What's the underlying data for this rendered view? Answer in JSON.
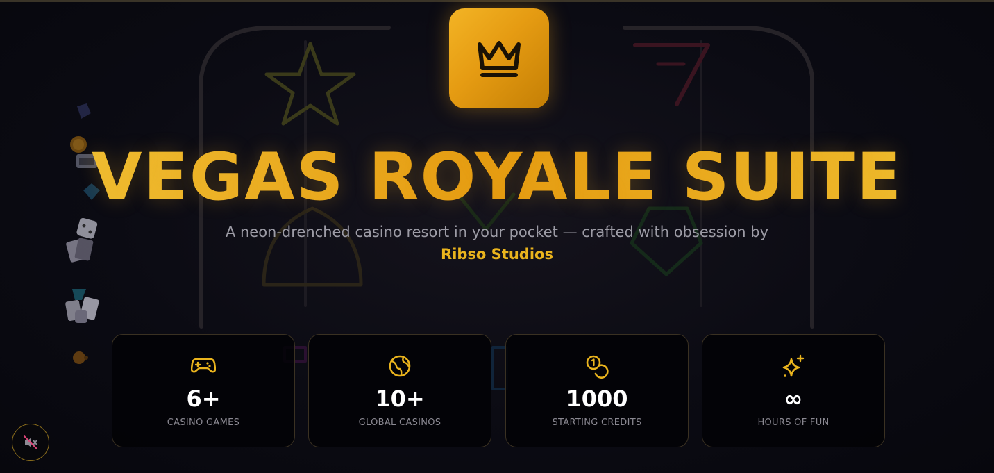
{
  "hero": {
    "logo_icon": "crown-icon",
    "title": "VEGAS ROYALE SUITE",
    "subtitle": "A neon-drenched casino resort in your pocket — crafted with obsession by",
    "studio": "Ribso Studios"
  },
  "stats": [
    {
      "icon": "gamepad-icon",
      "value": "6+",
      "label": "CASINO GAMES"
    },
    {
      "icon": "globe-icon",
      "value": "10+",
      "label": "GLOBAL CASINOS"
    },
    {
      "icon": "coins-icon",
      "value": "1000",
      "label": "STARTING CREDITS"
    },
    {
      "icon": "sparkles-icon",
      "value": "∞",
      "label": "HOURS OF FUN"
    }
  ],
  "sound_toggle": {
    "icon": "muted-speaker-icon"
  },
  "colors": {
    "gold": "#eab41d",
    "gold_dark": "#c47f05",
    "background": "#0b0b14",
    "card_border": "#3a3122",
    "muted_text": "#8a8891"
  }
}
